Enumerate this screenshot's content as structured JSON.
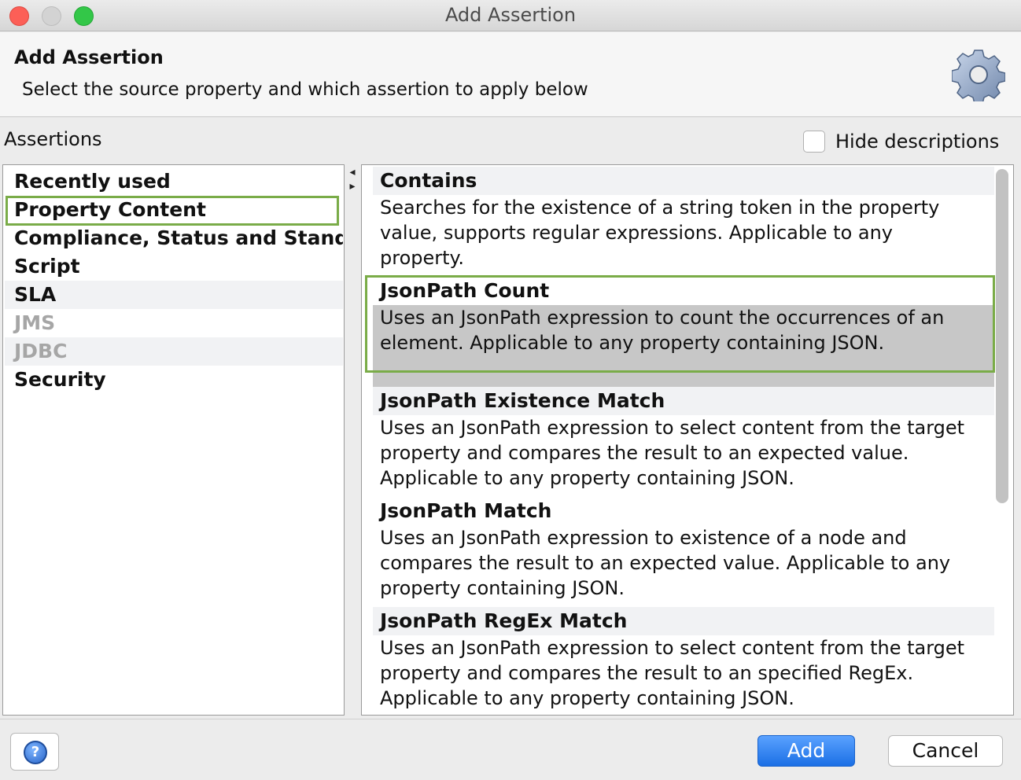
{
  "window": {
    "title": "Add Assertion"
  },
  "header": {
    "title": "Add Assertion",
    "description": "Select the source property and which assertion to apply below"
  },
  "assertions_label": "Assertions",
  "hide_descriptions": {
    "label": "Hide descriptions",
    "checked": false
  },
  "categories": [
    {
      "label": "Recently used",
      "enabled": true
    },
    {
      "label": "Property Content",
      "enabled": true,
      "selected": true
    },
    {
      "label": "Compliance, Status and Stand...",
      "enabled": true
    },
    {
      "label": "Script",
      "enabled": true
    },
    {
      "label": "SLA",
      "enabled": true
    },
    {
      "label": "JMS",
      "enabled": false
    },
    {
      "label": "JDBC",
      "enabled": false
    },
    {
      "label": "Security",
      "enabled": true
    }
  ],
  "assertions": [
    {
      "title": "Contains",
      "description_lines": [
        "Searches for the existence of a string token in the property",
        "value, supports regular expressions. Applicable to any",
        "property."
      ]
    },
    {
      "title": "JsonPath Count",
      "selected": true,
      "description_lines": [
        "Uses an JsonPath expression to count the occurrences of an",
        "element. Applicable to any property containing JSON."
      ]
    },
    {
      "title": "JsonPath Existence Match",
      "description_lines": [
        "Uses an JsonPath expression to select content from the target",
        "property and compares the result to an expected value.",
        "Applicable to any property containing JSON."
      ]
    },
    {
      "title": "JsonPath Match",
      "description_lines": [
        "Uses an JsonPath expression to existence of a node and",
        "compares the result to an expected value. Applicable to any",
        "property containing JSON."
      ]
    },
    {
      "title": "JsonPath RegEx Match",
      "description_lines": [
        "Uses an JsonPath expression to select content from the target",
        "property and compares the result to an specified RegEx.",
        "Applicable to any property containing JSON."
      ]
    }
  ],
  "buttons": {
    "add": "Add",
    "cancel": "Cancel"
  },
  "colors": {
    "highlight_border": "#7aac48",
    "primary_button": "#1b6fe5",
    "selected_row": "#c7c7c7"
  }
}
